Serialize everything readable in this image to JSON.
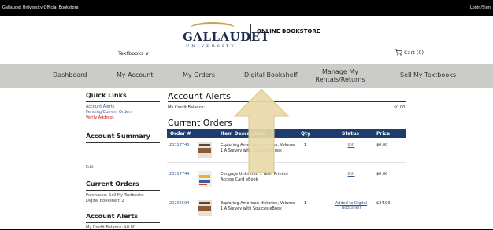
{
  "topbar": {
    "left": "Gallaudet University Official Bookstore",
    "right": "Login/Sign"
  },
  "logo": {
    "name": "GALLAUDET",
    "sub": "UNIVERSITY"
  },
  "header": {
    "store_name": "ONLINE BOOKSTORE",
    "textbooks": "Textbooks ∨",
    "cart": "Cart (0)"
  },
  "nav": [
    "Dashboard",
    "My Account",
    "My Orders",
    "Digital Bookshelf",
    "Manage My Rentals/Returns",
    "Sell My Textbooks"
  ],
  "left": {
    "quick_links_title": "Quick Links",
    "quick_links": [
      "Account Alerts",
      "Pending/Current Orders"
    ],
    "verify": "Verify Address",
    "summary_title": "Account Summary",
    "edit": "Edit",
    "current_orders_title": "Current Orders",
    "purchased": "Purchased: Sell My Textbooks",
    "digital": "Digital Bookshelf: 2",
    "alerts_title": "Account Alerts",
    "credit_cut": "My Credit Balance: $0.00"
  },
  "main": {
    "alerts_title": "Account Alerts",
    "credit_label": "My Credit Balance:",
    "credit_value": "$0.00",
    "orders_title": "Current Orders"
  },
  "table": {
    "headers": [
      "Order #",
      "Item Description",
      "Qty",
      "Status",
      "Price"
    ],
    "rows": [
      {
        "order": "20317745",
        "desc": "Exploring American Histories, Volume 1 A Survey with Sources eBook",
        "qty": "1",
        "status": "Gift",
        "price": "$0.00"
      },
      {
        "order": "20317744",
        "desc": "Cengage Unlimited 1 Term Printed Access Card eBook",
        "qty": "",
        "status": "Gift",
        "price": "$0.00"
      },
      {
        "order": "20205594",
        "desc": "Exploring American Histories, Volume 1 A Survey with Sources eBook",
        "qty": "1",
        "status": "Added to Digital Bookshelf",
        "price": "$34.99"
      }
    ]
  },
  "colors": {
    "nav_bg": "#cbcbc7",
    "table_header": "#1e3c6e",
    "link": "#345a8a",
    "arrow": "#e8d9a8",
    "gold": "#c9a24f"
  },
  "icons": {
    "cart": "cart-icon",
    "arrow": "pointer-arrow"
  }
}
